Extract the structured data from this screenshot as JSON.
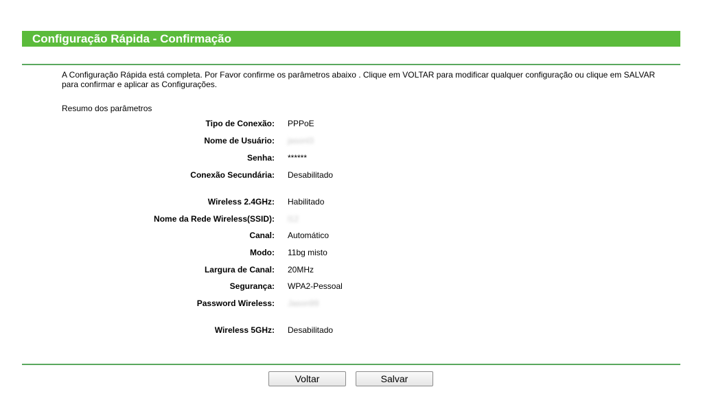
{
  "header": {
    "title": "Configuração Rápida - Confirmação"
  },
  "intro_text": "A Configuração Rápida está completa. Por Favor confirme os parâmetros abaixo . Clique em VOLTAR para modificar qualquer configuração ou clique em SALVAR para confirmar e aplicar as Configurações.",
  "summary_heading": "Resumo dos parâmetros",
  "internet": {
    "connection_type": {
      "label": "Tipo de Conexão:",
      "value": "PPPoE"
    },
    "username": {
      "label": "Nome de Usuário:",
      "value": "jasonl3"
    },
    "password": {
      "label": "Senha:",
      "value": "******"
    },
    "secondary_connection": {
      "label": "Conexão Secundária:",
      "value": "Desabilitado"
    }
  },
  "wireless_24": {
    "status": {
      "label": "Wireless 2.4GHz:",
      "value": "Habilitado"
    },
    "ssid": {
      "label": "Nome da Rede Wireless(SSID):",
      "value": "l12"
    },
    "channel": {
      "label": "Canal:",
      "value": "Automático"
    },
    "mode": {
      "label": "Modo:",
      "value": "11bg misto"
    },
    "channel_width": {
      "label": "Largura de Canal:",
      "value": "20MHz"
    },
    "security": {
      "label": "Segurança:",
      "value": "WPA2-Pessoal"
    },
    "wireless_password": {
      "label": "Password Wireless:",
      "value": "Jason99"
    }
  },
  "wireless_5": {
    "status": {
      "label": "Wireless 5GHz:",
      "value": "Desabilitado"
    }
  },
  "buttons": {
    "back": "Voltar",
    "save": "Salvar"
  },
  "colors": {
    "title_bar": "#5bbb3b",
    "divider": "#5aa85e"
  }
}
